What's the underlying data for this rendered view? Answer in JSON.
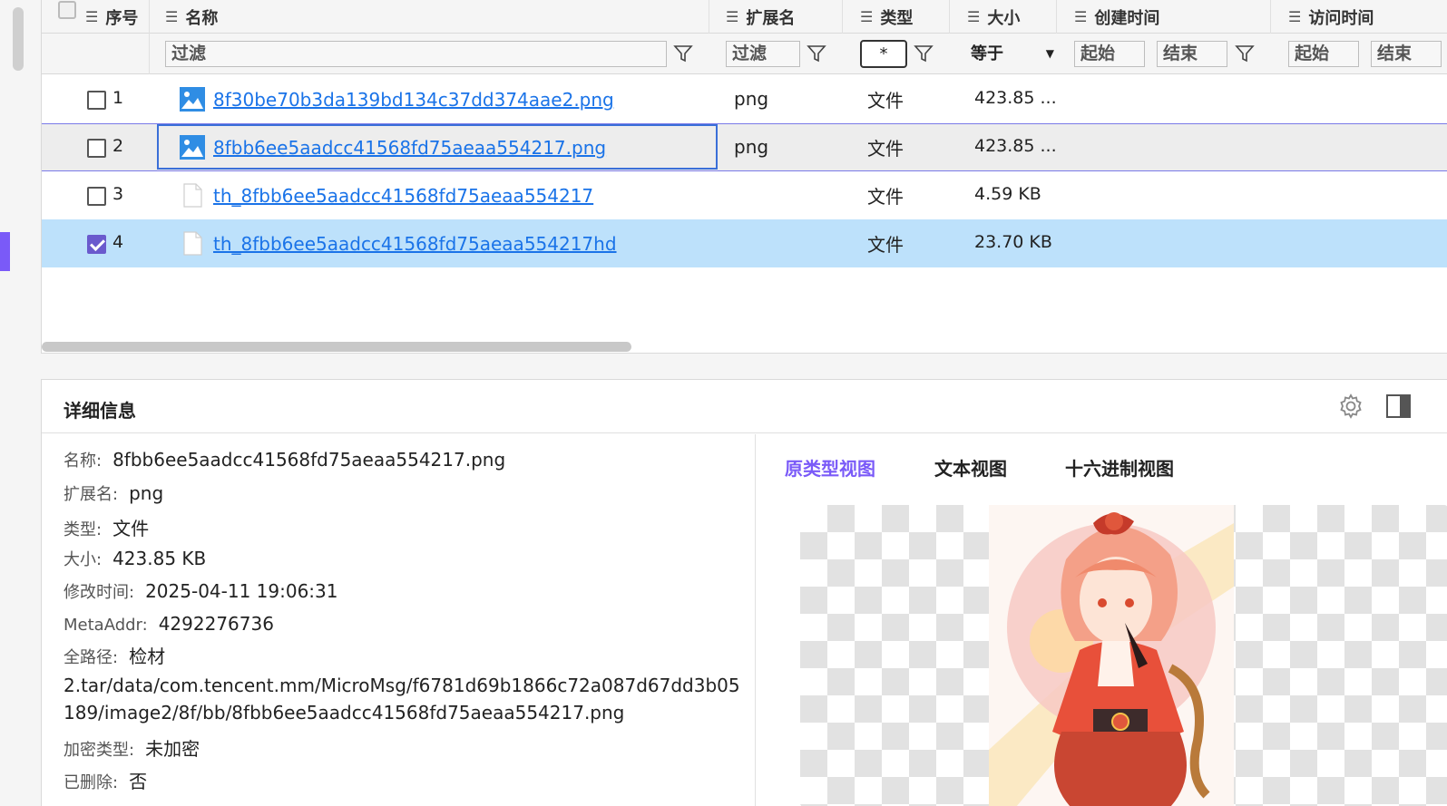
{
  "table": {
    "headers": {
      "index": "序号",
      "name": "名称",
      "ext": "扩展名",
      "type": "类型",
      "size": "大小",
      "created": "创建时间",
      "accessed": "访问时间"
    },
    "filters": {
      "name_placeholder": "过滤",
      "ext_placeholder": "过滤",
      "type_value": "*",
      "size_op": "等于",
      "created_start": "起始",
      "created_end": "结束",
      "accessed_start": "起始",
      "accessed_end": "结束"
    },
    "rows": [
      {
        "index": "1",
        "name": "8f30be70b3da139bd134c37dd374aae2.png",
        "ext": "png",
        "type": "文件",
        "size": "423.85 ...",
        "icon": "image-file-icon",
        "checked": false
      },
      {
        "index": "2",
        "name": "8fbb6ee5aadcc41568fd75aeaa554217.png",
        "ext": "png",
        "type": "文件",
        "size": "423.85 ...",
        "icon": "image-file-icon",
        "checked": false
      },
      {
        "index": "3",
        "name": "th_8fbb6ee5aadcc41568fd75aeaa554217",
        "ext": "",
        "type": "文件",
        "size": "4.59 KB",
        "icon": "blank-file-icon",
        "checked": false
      },
      {
        "index": "4",
        "name": "th_8fbb6ee5aadcc41568fd75aeaa554217hd",
        "ext": "",
        "type": "文件",
        "size": "23.70 KB",
        "icon": "blank-file-icon",
        "checked": true
      }
    ]
  },
  "detail": {
    "title": "详细信息",
    "fields": {
      "name_k": "名称:",
      "name_v": "8fbb6ee5aadcc41568fd75aeaa554217.png",
      "ext_k": "扩展名:",
      "ext_v": "png",
      "type_k": "类型:",
      "type_v": "文件",
      "size_k": "大小:",
      "size_v": "423.85 KB",
      "mtime_k": "修改时间:",
      "mtime_v": "2025-04-11 19:06:31",
      "meta_k": "MetaAddr:",
      "meta_v": "4292276736",
      "path_k": "全路径:",
      "path_v1": "检材",
      "path_v2": "2.tar/data/com.tencent.mm/MicroMsg/f6781d69b1866c72a087d67dd3b05",
      "path_v3": "189/image2/8f/bb/8fbb6ee5aadcc41568fd75aeaa554217.png",
      "enc_k": "加密类型:",
      "enc_v": "未加密",
      "del_k": "已删除:",
      "del_v": "否"
    },
    "tabs": {
      "original": "原类型视图",
      "text": "文本视图",
      "hex": "十六进制视图"
    }
  },
  "colors": {
    "accent": "#7a5af8",
    "link": "#1a73e8",
    "selected_row": "#bde1fb"
  }
}
